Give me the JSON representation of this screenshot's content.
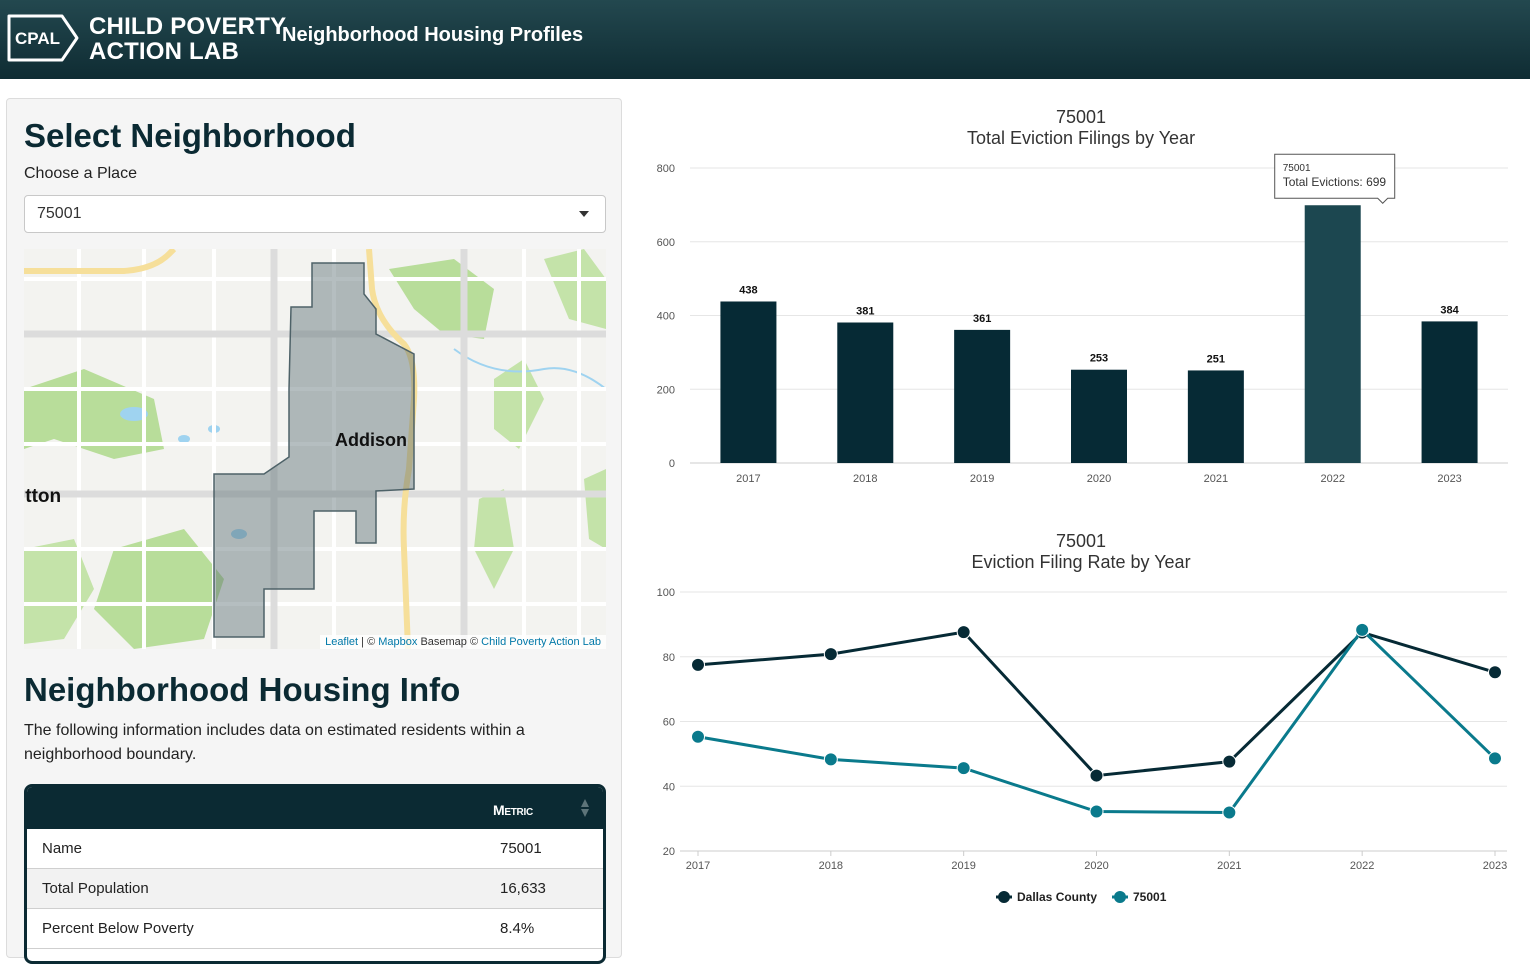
{
  "header": {
    "logo_abbrev": "CPAL",
    "logo_line1": "CHILD POVERTY",
    "logo_line2": "ACTION LAB",
    "title": "Neighborhood Housing Profiles"
  },
  "sidebar": {
    "select_heading": "Select Neighborhood",
    "place_label": "Choose a Place",
    "place_value": "75001",
    "map": {
      "labels": [
        "Addison",
        "ltton"
      ],
      "attribution": {
        "leaflet": "Leaflet",
        "sep1": " | © ",
        "mapbox": "Mapbox",
        "basemap": " Basemap © ",
        "cpal": "Child Poverty Action Lab"
      }
    },
    "info_heading": "Neighborhood Housing Info",
    "info_description": "The following information includes data on estimated residents within a neighborhood boundary.",
    "table": {
      "column_header": "Metric",
      "rows": [
        {
          "name": "Name",
          "value": "75001"
        },
        {
          "name": "Total Population",
          "value": "16,633"
        },
        {
          "name": "Percent Below Poverty",
          "value": "8.4%"
        }
      ]
    }
  },
  "colors": {
    "header_bg": "#0f2c33",
    "bar": "#062a35",
    "bar_highlight": "#1c4750",
    "dallas_line": "#062a35",
    "zip_line": "#0a7a8c"
  },
  "chart_data": [
    {
      "type": "bar",
      "title": "75001",
      "subtitle": "Total Eviction Filings by Year",
      "categories": [
        "2017",
        "2018",
        "2019",
        "2020",
        "2021",
        "2022",
        "2023"
      ],
      "values": [
        438,
        381,
        361,
        253,
        251,
        699,
        384
      ],
      "ylim": [
        0,
        800
      ],
      "yticks": [
        0,
        200,
        400,
        600,
        800
      ],
      "grid": true,
      "tooltip": {
        "series": "75001",
        "label": "Total Evictions: 699",
        "category": "2022"
      }
    },
    {
      "type": "line",
      "title": "75001",
      "subtitle": "Eviction Filing Rate by Year",
      "x": [
        "2017",
        "2018",
        "2019",
        "2020",
        "2021",
        "2022",
        "2023"
      ],
      "ylim": [
        20,
        100
      ],
      "yticks": [
        20,
        40,
        60,
        80,
        100
      ],
      "grid": true,
      "legend": "bottom-center",
      "series": [
        {
          "name": "Dallas County",
          "values": [
            77.5,
            80.8,
            87.6,
            43.3,
            47.6,
            87.5,
            75.2
          ]
        },
        {
          "name": "75001",
          "values": [
            55.3,
            48.3,
            45.6,
            32.2,
            31.9,
            88.3,
            48.6
          ]
        }
      ]
    }
  ]
}
